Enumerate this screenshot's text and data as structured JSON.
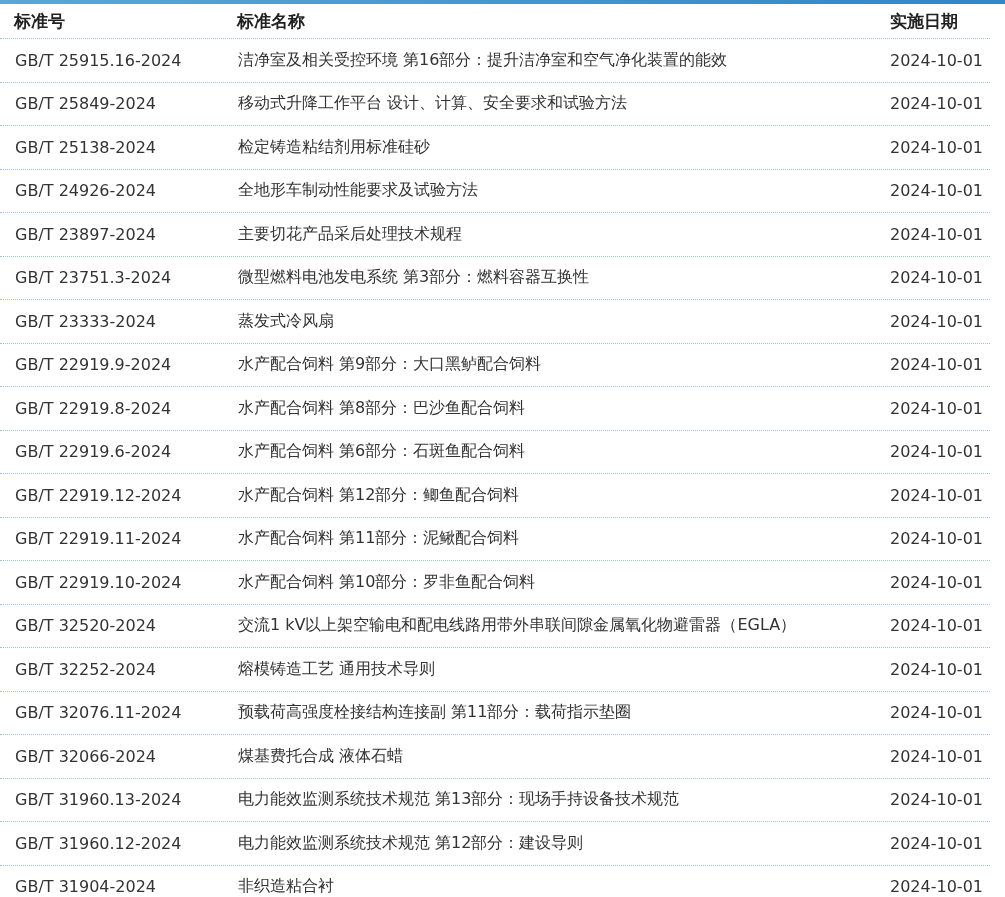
{
  "table": {
    "columns": [
      "标准号",
      "标准名称",
      "实施日期"
    ],
    "rows": [
      [
        "GB/T 25915.16-2024",
        "洁净室及相关受控环境 第16部分：提升洁净室和空气净化装置的能效",
        "2024-10-01"
      ],
      [
        "GB/T 25849-2024",
        "移动式升降工作平台 设计、计算、安全要求和试验方法",
        "2024-10-01"
      ],
      [
        "GB/T 25138-2024",
        "检定铸造粘结剂用标准硅砂",
        "2024-10-01"
      ],
      [
        "GB/T 24926-2024",
        "全地形车制动性能要求及试验方法",
        "2024-10-01"
      ],
      [
        "GB/T 23897-2024",
        "主要切花产品采后处理技术规程",
        "2024-10-01"
      ],
      [
        "GB/T 23751.3-2024",
        "微型燃料电池发电系统 第3部分：燃料容器互换性",
        "2024-10-01"
      ],
      [
        "GB/T 23333-2024",
        "蒸发式冷风扇",
        "2024-10-01"
      ],
      [
        "GB/T 22919.9-2024",
        "水产配合饲料 第9部分：大口黑鲈配合饲料",
        "2024-10-01"
      ],
      [
        "GB/T 22919.8-2024",
        "水产配合饲料 第8部分：巴沙鱼配合饲料",
        "2024-10-01"
      ],
      [
        "GB/T 22919.6-2024",
        "水产配合饲料 第6部分：石斑鱼配合饲料",
        "2024-10-01"
      ],
      [
        "GB/T 22919.12-2024",
        "水产配合饲料 第12部分：鲫鱼配合饲料",
        "2024-10-01"
      ],
      [
        "GB/T 22919.11-2024",
        "水产配合饲料 第11部分：泥鳅配合饲料",
        "2024-10-01"
      ],
      [
        "GB/T 22919.10-2024",
        "水产配合饲料 第10部分：罗非鱼配合饲料",
        "2024-10-01"
      ],
      [
        "GB/T 32520-2024",
        "交流1 kV以上架空输电和配电线路用带外串联间隙金属氧化物避雷器（EGLA）",
        "2024-10-01"
      ],
      [
        "GB/T 32252-2024",
        "熔模铸造工艺 通用技术导则",
        "2024-10-01"
      ],
      [
        "GB/T 32076.11-2024",
        "预载荷高强度栓接结构连接副 第11部分：载荷指示垫圈",
        "2024-10-01"
      ],
      [
        "GB/T 32066-2024",
        "煤基费托合成 液体石蜡",
        "2024-10-01"
      ],
      [
        "GB/T 31960.13-2024",
        "电力能效监测系统技术规范 第13部分：现场手持设备技术规范",
        "2024-10-01"
      ],
      [
        "GB/T 31960.12-2024",
        "电力能效监测系统技术规范 第12部分：建设导则",
        "2024-10-01"
      ],
      [
        "GB/T 31904-2024",
        "非织造粘合衬",
        "2024-10-01"
      ]
    ]
  }
}
